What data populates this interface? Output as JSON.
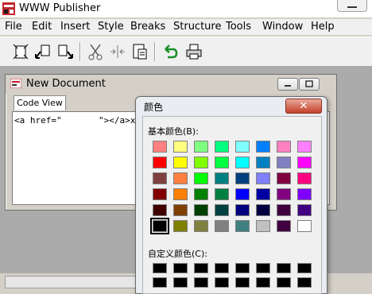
{
  "app": {
    "title": "WWW Publisher"
  },
  "menu": [
    "File",
    "Edit",
    "Insert",
    "Style",
    "Breaks",
    "Structure",
    "Tools",
    "Window",
    "Help"
  ],
  "toolbar": {
    "icons": [
      "new-icon",
      "open-icon",
      "save-icon",
      "cut-icon",
      "split-icon",
      "paste-icon",
      "undo-icon",
      "print-icon"
    ]
  },
  "document": {
    "title": "New Document",
    "tab": "Code View",
    "code": "<a href=\"       \"></a>xoo"
  },
  "color_dialog": {
    "title": "颜色",
    "close_label": "✕",
    "basic_label": "基本颜色(B):",
    "custom_label": "自定义颜色(C):",
    "basic_colors": [
      "#ff8080",
      "#ffff80",
      "#80ff80",
      "#00ff80",
      "#80ffff",
      "#0080ff",
      "#ff80c0",
      "#ff80ff",
      "#ff0000",
      "#ffff00",
      "#80ff00",
      "#00ff40",
      "#00ffff",
      "#0080c0",
      "#8080c0",
      "#ff00ff",
      "#804040",
      "#ff8040",
      "#00ff00",
      "#008080",
      "#004080",
      "#8080ff",
      "#800040",
      "#ff0080",
      "#800000",
      "#ff8000",
      "#008000",
      "#008040",
      "#0000ff",
      "#0000a0",
      "#800080",
      "#8000ff",
      "#400000",
      "#804000",
      "#004000",
      "#004040",
      "#000080",
      "#000040",
      "#400040",
      "#400080",
      "#000000",
      "#808000",
      "#808040",
      "#808080",
      "#408080",
      "#c0c0c0",
      "#400040",
      "#ffffff"
    ],
    "selected_index": 40,
    "custom_colors": [
      "#000000",
      "#000000",
      "#000000",
      "#000000",
      "#000000",
      "#000000",
      "#000000",
      "#000000",
      "#000000",
      "#000000",
      "#000000",
      "#000000",
      "#000000",
      "#000000",
      "#000000",
      "#000000"
    ]
  }
}
